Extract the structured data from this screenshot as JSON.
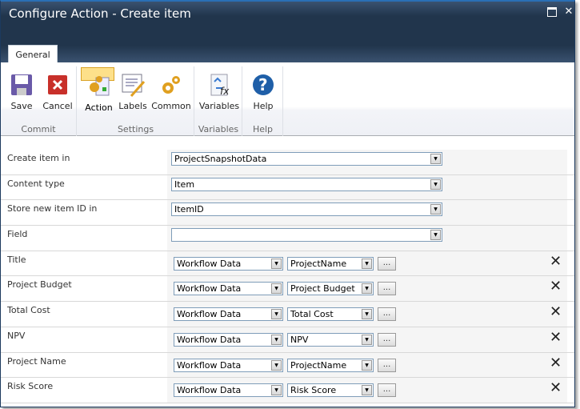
{
  "window": {
    "title": "Configure Action - Create item",
    "maximize_icon": "maximize-icon",
    "close_icon": "close-icon"
  },
  "ribbon": {
    "tab": "General",
    "groups": {
      "commit": "Commit",
      "settings": "Settings",
      "variables": "Variables",
      "help": "Help"
    },
    "buttons": {
      "save": "Save",
      "cancel": "Cancel",
      "action": "Action",
      "labels": "Labels",
      "common": "Common",
      "variables": "Variables",
      "help": "Help"
    }
  },
  "form": {
    "create_item_in": {
      "label": "Create item in",
      "value": "ProjectSnapshotData"
    },
    "content_type": {
      "label": "Content type",
      "value": "Item"
    },
    "store_id": {
      "label": "Store new item ID in",
      "value": "ItemID"
    },
    "field": {
      "label": "Field",
      "value": ""
    },
    "fields": [
      {
        "label": "Title",
        "source": "Workflow Data",
        "value": "ProjectName"
      },
      {
        "label": "Project Budget",
        "source": "Workflow Data",
        "value": "Project Budget"
      },
      {
        "label": "Total Cost",
        "source": "Workflow Data",
        "value": "Total Cost"
      },
      {
        "label": "NPV",
        "source": "Workflow Data",
        "value": "NPV"
      },
      {
        "label": "Project Name",
        "source": "Workflow Data",
        "value": "ProjectName"
      },
      {
        "label": "Risk Score",
        "source": "Workflow Data",
        "value": "Risk Score"
      }
    ],
    "ellipsis": "...",
    "delete_glyph": "✕"
  }
}
